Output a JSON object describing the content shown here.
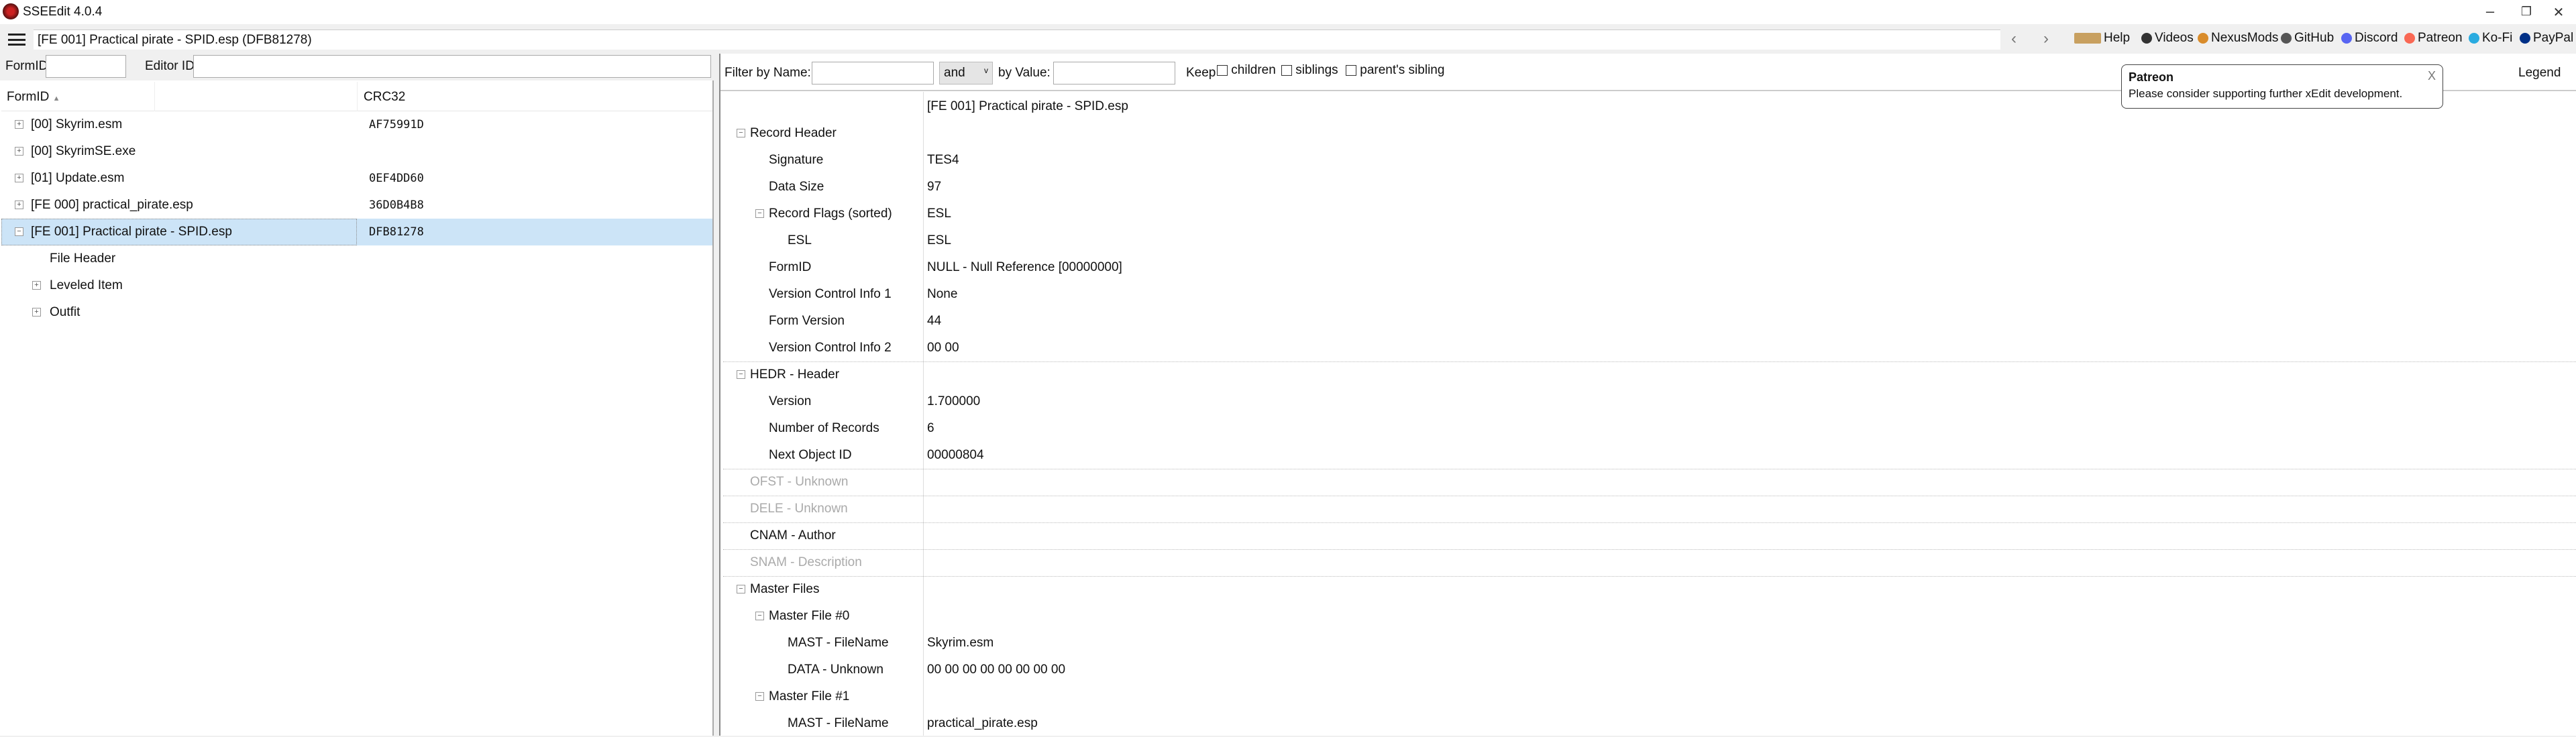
{
  "window": {
    "title": "SSEEdit 4.0.4",
    "minimize": "–",
    "maximize": "❐",
    "close": "✕"
  },
  "toolbar": {
    "path": "[FE 001] Practical pirate - SPID.esp (DFB81278)",
    "back": "‹",
    "forward": "›",
    "links": [
      {
        "label": "Help",
        "icon": "book-icon",
        "color": "#c8a060"
      },
      {
        "label": "Videos",
        "icon": "video-icon",
        "color": "#333"
      },
      {
        "label": "NexusMods",
        "icon": "nexusmods-icon",
        "color": "#d98c2b"
      },
      {
        "label": "GitHub",
        "icon": "github-icon",
        "color": "#555"
      },
      {
        "label": "Discord",
        "icon": "discord-icon",
        "color": "#5865f2"
      },
      {
        "label": "Patreon",
        "icon": "patreon-icon",
        "color": "#f96854"
      },
      {
        "label": "Ko-Fi",
        "icon": "kofi-icon",
        "color": "#29abe0"
      },
      {
        "label": "PayPal",
        "icon": "paypal-icon",
        "color": "#003087"
      }
    ]
  },
  "left": {
    "formid_label": "FormID",
    "editorid_label": "Editor ID",
    "formid_value": "",
    "editorid_value": "",
    "columns": {
      "formid": "FormID",
      "sort": "▲",
      "crc": "CRC32"
    },
    "rows": [
      {
        "name": "[00] Skyrim.esm",
        "crc": "AF75991D",
        "exp": "+"
      },
      {
        "name": "[00] SkyrimSE.exe",
        "crc": "",
        "exp": "+"
      },
      {
        "name": "[01] Update.esm",
        "crc": "0EF4DD60",
        "exp": "+"
      },
      {
        "name": "[FE 000] practical_pirate.esp",
        "crc": "36D0B4B8",
        "exp": "+"
      },
      {
        "name": "[FE 001] Practical pirate - SPID.esp",
        "crc": "DFB81278",
        "exp": "−",
        "selected": true
      }
    ],
    "children": [
      {
        "name": "File Header",
        "exp": ""
      },
      {
        "name": "Leveled Item",
        "exp": "+"
      },
      {
        "name": "Outfit",
        "exp": "+"
      }
    ]
  },
  "right": {
    "filter_name_label": "Filter by Name:",
    "filter_name_value": "",
    "operator": "and",
    "filter_value_label": "by Value:",
    "filter_value_value": "",
    "keep_label": "Keep",
    "keep_children": "children",
    "keep_siblings": "siblings",
    "keep_parents_sibling": "parent's sibling",
    "legend": "Legend",
    "header_value": "[FE 001] Practical pirate - SPID.esp",
    "rows": [
      {
        "name": "Record Header",
        "value": "",
        "level": 0,
        "exp": "−"
      },
      {
        "name": "Signature",
        "value": "TES4",
        "level": 1
      },
      {
        "name": "Data Size",
        "value": "97",
        "level": 1
      },
      {
        "name": "Record Flags (sorted)",
        "value": "ESL",
        "level": 1,
        "exp": "−"
      },
      {
        "name": "ESL",
        "value": "ESL",
        "level": 2
      },
      {
        "name": "FormID",
        "value": "NULL - Null Reference [00000000]",
        "level": 1
      },
      {
        "name": "Version Control Info 1",
        "value": "None",
        "level": 1
      },
      {
        "name": "Form Version",
        "value": "44",
        "level": 1
      },
      {
        "name": "Version Control Info 2",
        "value": "00 00",
        "level": 1,
        "sep": true
      },
      {
        "name": "HEDR - Header",
        "value": "",
        "level": 0,
        "exp": "−"
      },
      {
        "name": "Version",
        "value": "1.700000",
        "level": 1
      },
      {
        "name": "Number of Records",
        "value": "6",
        "level": 1
      },
      {
        "name": "Next Object ID",
        "value": "00000804",
        "level": 1,
        "sep": true
      },
      {
        "name": "OFST - Unknown",
        "value": "",
        "level": 0,
        "grey": true,
        "sep": true
      },
      {
        "name": "DELE - Unknown",
        "value": "",
        "level": 0,
        "grey": true,
        "sep": true
      },
      {
        "name": "CNAM - Author",
        "value": "",
        "level": 0,
        "sep": true
      },
      {
        "name": "SNAM - Description",
        "value": "",
        "level": 0,
        "grey": true,
        "sep": true
      },
      {
        "name": "Master Files",
        "value": "",
        "level": 0,
        "exp": "−"
      },
      {
        "name": "Master File #0",
        "value": "",
        "level": 1,
        "exp": "−"
      },
      {
        "name": "MAST - FileName",
        "value": "Skyrim.esm",
        "level": 2
      },
      {
        "name": "DATA - Unknown",
        "value": "00 00 00 00 00 00 00 00",
        "level": 2
      },
      {
        "name": "Master File #1",
        "value": "",
        "level": 1,
        "exp": "−"
      },
      {
        "name": "MAST - FileName",
        "value": "practical_pirate.esp",
        "level": 2
      }
    ]
  },
  "tooltip": {
    "title": "Patreon",
    "body": "Please consider supporting further xEdit development.",
    "close": "X"
  }
}
